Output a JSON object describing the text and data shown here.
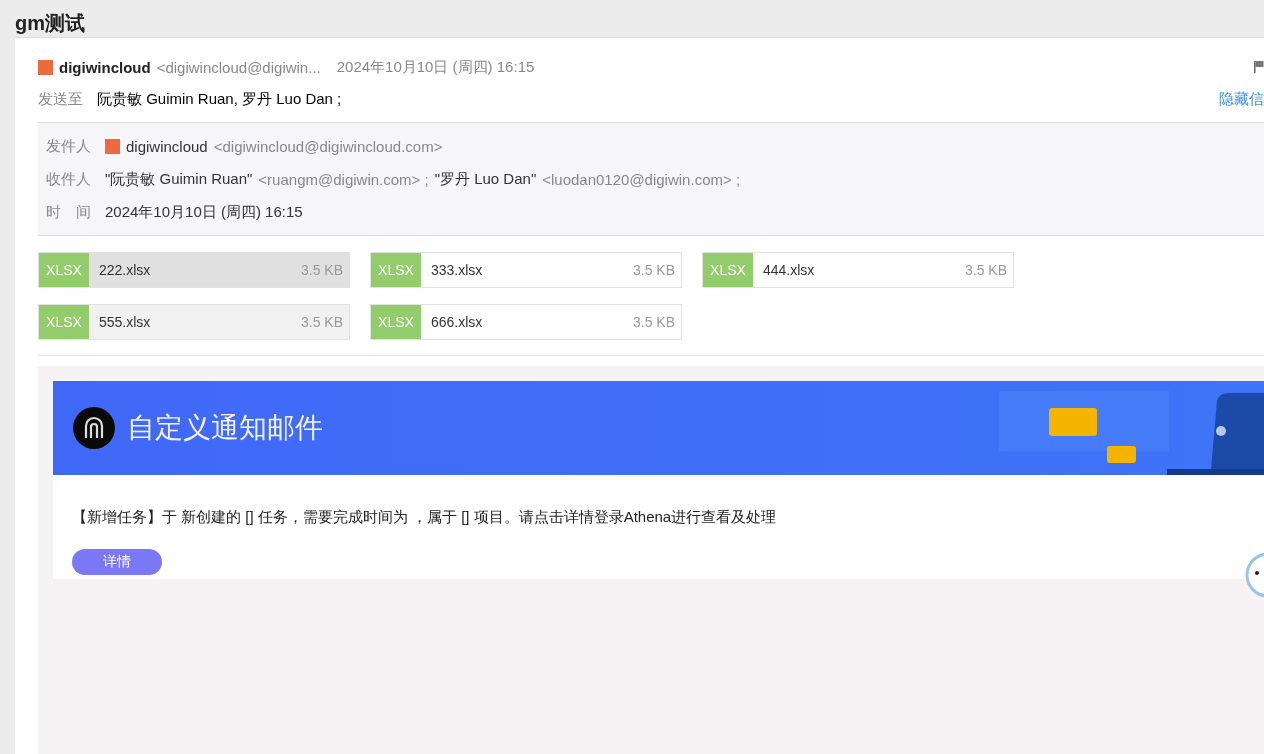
{
  "page_title": "gm测试",
  "header": {
    "sender_name": "digiwincloud",
    "sender_email": "<digiwincloud@digiwin...",
    "date": "2024年10月10日 (周四) 16:15",
    "to_label": "发送至",
    "to_value": "阮贵敏 Guimin Ruan, 罗丹 Luo Dan ;",
    "hide_link": "隐藏信"
  },
  "details": [
    {
      "kind": "sender",
      "label": "发件人",
      "name": "digiwincloud",
      "email": "<digiwincloud@digiwincloud.com>"
    },
    {
      "kind": "recipients",
      "label": "收件人",
      "recipients": [
        {
          "name": "\"阮贵敏 Guimin Ruan\"",
          "email": "<ruangm@digiwin.com> ;"
        },
        {
          "name": "\"罗丹 Luo Dan\"",
          "email": "<luodan0120@digiwin.com> ;"
        }
      ]
    },
    {
      "kind": "time",
      "label": "时　间",
      "value": "2024年10月10日 (周四) 16:15"
    }
  ],
  "attachments": [
    {
      "type": "XLSX",
      "name": "222.xlsx",
      "size": "3.5 KB",
      "selected": true,
      "hovered": false
    },
    {
      "type": "XLSX",
      "name": "333.xlsx",
      "size": "3.5 KB",
      "selected": false,
      "hovered": false
    },
    {
      "type": "XLSX",
      "name": "444.xlsx",
      "size": "3.5 KB",
      "selected": false,
      "hovered": false
    },
    {
      "type": "XLSX",
      "name": "555.xlsx",
      "size": "3.5 KB",
      "selected": false,
      "hovered": true
    },
    {
      "type": "XLSX",
      "name": "666.xlsx",
      "size": "3.5 KB",
      "selected": false,
      "hovered": false
    }
  ],
  "notice": {
    "banner_title": "自定义通知邮件",
    "message": "【新增任务】于 新创建的 [] 任务，需要完成时间为 ，属于 [] 项目。请点击详情登录Athena进行查看及处理",
    "button": "详情"
  }
}
